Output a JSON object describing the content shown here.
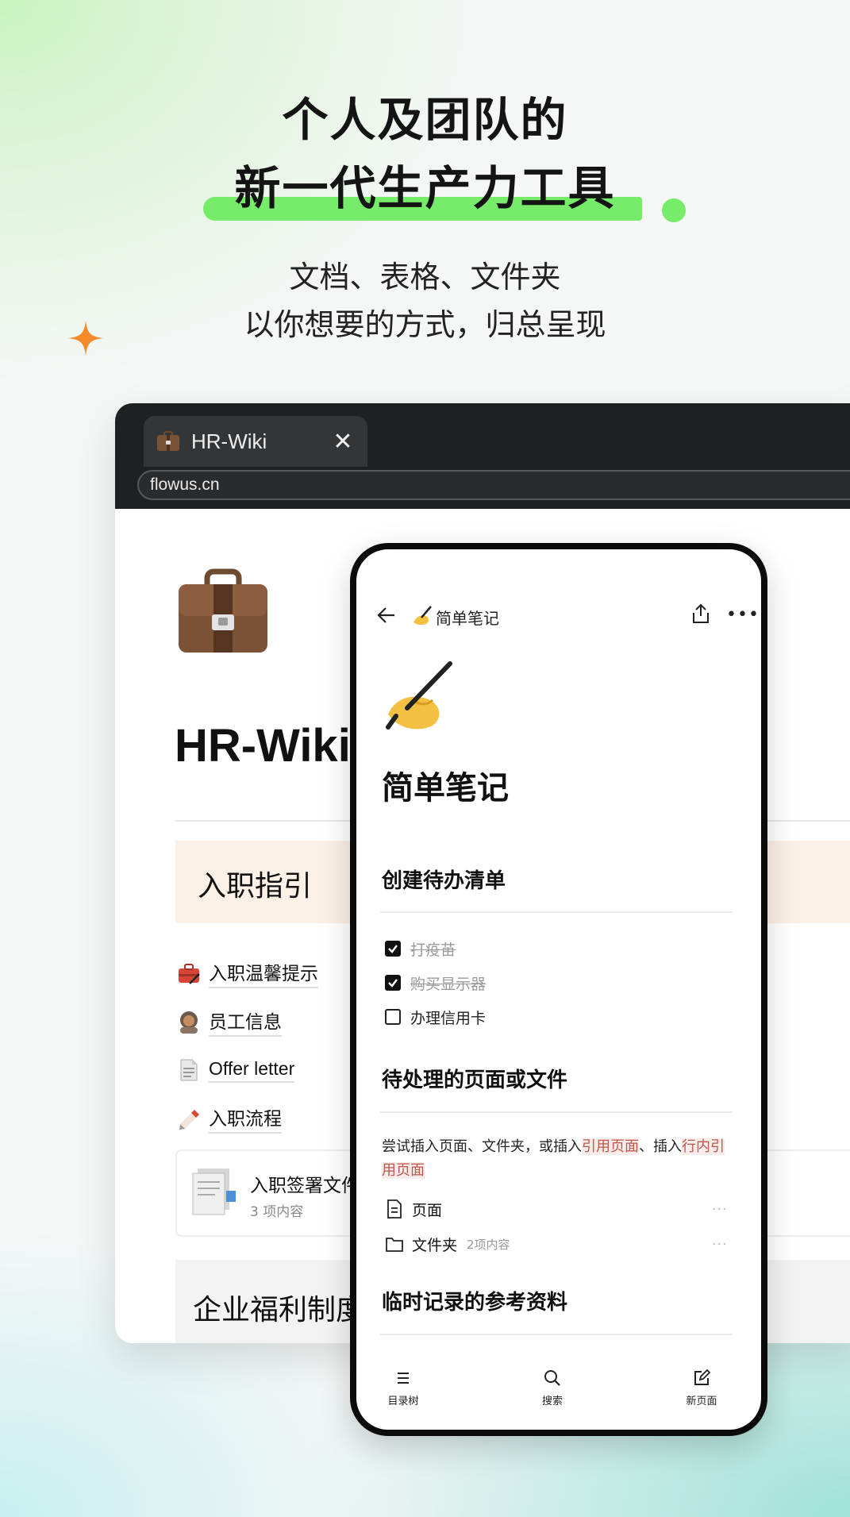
{
  "hero": {
    "line1": "个人及团队的",
    "line2": "新一代生产力工具",
    "sub1": "文档、表格、文件夹",
    "sub2": "以你想要的方式，归总呈现",
    "accent_color": "#76ec6a",
    "sparkle_color": "#f58a2a"
  },
  "browser": {
    "tab_title": "HR-Wiki",
    "tab_icon": "briefcase-icon",
    "url": "flowus.cn",
    "page_title": "HR-Wiki",
    "callout": "入职指引",
    "items": [
      {
        "icon": "toolbox-icon",
        "label": "入职温馨提示"
      },
      {
        "icon": "person-icon",
        "label": "员工信息"
      },
      {
        "icon": "document-icon",
        "label": "Offer letter"
      },
      {
        "icon": "pencil-icon",
        "label": "入职流程"
      }
    ],
    "folder": {
      "title": "入职签署文件",
      "count": "3 项内容"
    },
    "section2": "企业福利制度"
  },
  "phone": {
    "nav_title": "简单笔记",
    "page_title": "简单笔记",
    "section1": "创建待办清单",
    "todos": [
      {
        "label": "打疫苗",
        "done": true
      },
      {
        "label": "购买显示器",
        "done": true
      },
      {
        "label": "办理信用卡",
        "done": false
      }
    ],
    "section2": "待处理的页面或文件",
    "para_text1": "尝试插入页面、文件夹，或插入",
    "para_link1": "引用页面",
    "para_text2": "、插入",
    "para_link2": "行内引用页面",
    "rows": [
      {
        "icon": "page-icon",
        "label": "页面",
        "count": ""
      },
      {
        "icon": "folder-icon",
        "label": "文件夹",
        "count": "2项内容"
      }
    ],
    "section3": "临时记录的参考资料",
    "tabs": [
      {
        "icon": "list-icon",
        "label": "目录树"
      },
      {
        "icon": "search-icon",
        "label": "搜索"
      },
      {
        "icon": "edit-icon",
        "label": "新页面"
      }
    ]
  }
}
